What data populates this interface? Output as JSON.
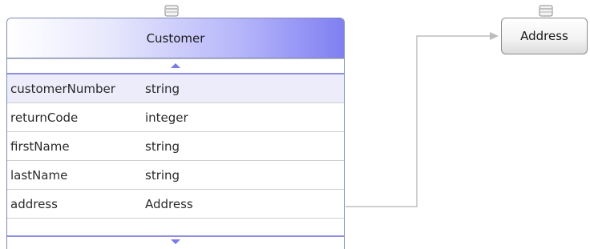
{
  "customer": {
    "title": "Customer",
    "fields": [
      {
        "name": "customerNumber",
        "type": "string"
      },
      {
        "name": "returnCode",
        "type": "integer"
      },
      {
        "name": "firstName",
        "type": "string"
      },
      {
        "name": "lastName",
        "type": "string"
      },
      {
        "name": "address",
        "type": "Address"
      }
    ]
  },
  "address": {
    "title": "Address"
  },
  "icons": {
    "entity": "database-table-icon",
    "scroll_up": "triangle-up-icon",
    "scroll_down": "triangle-down-icon"
  },
  "colors": {
    "header_gradient_end": "#7f7ff2",
    "connector": "#b0b0b0",
    "selected_row": "#ececfb"
  }
}
